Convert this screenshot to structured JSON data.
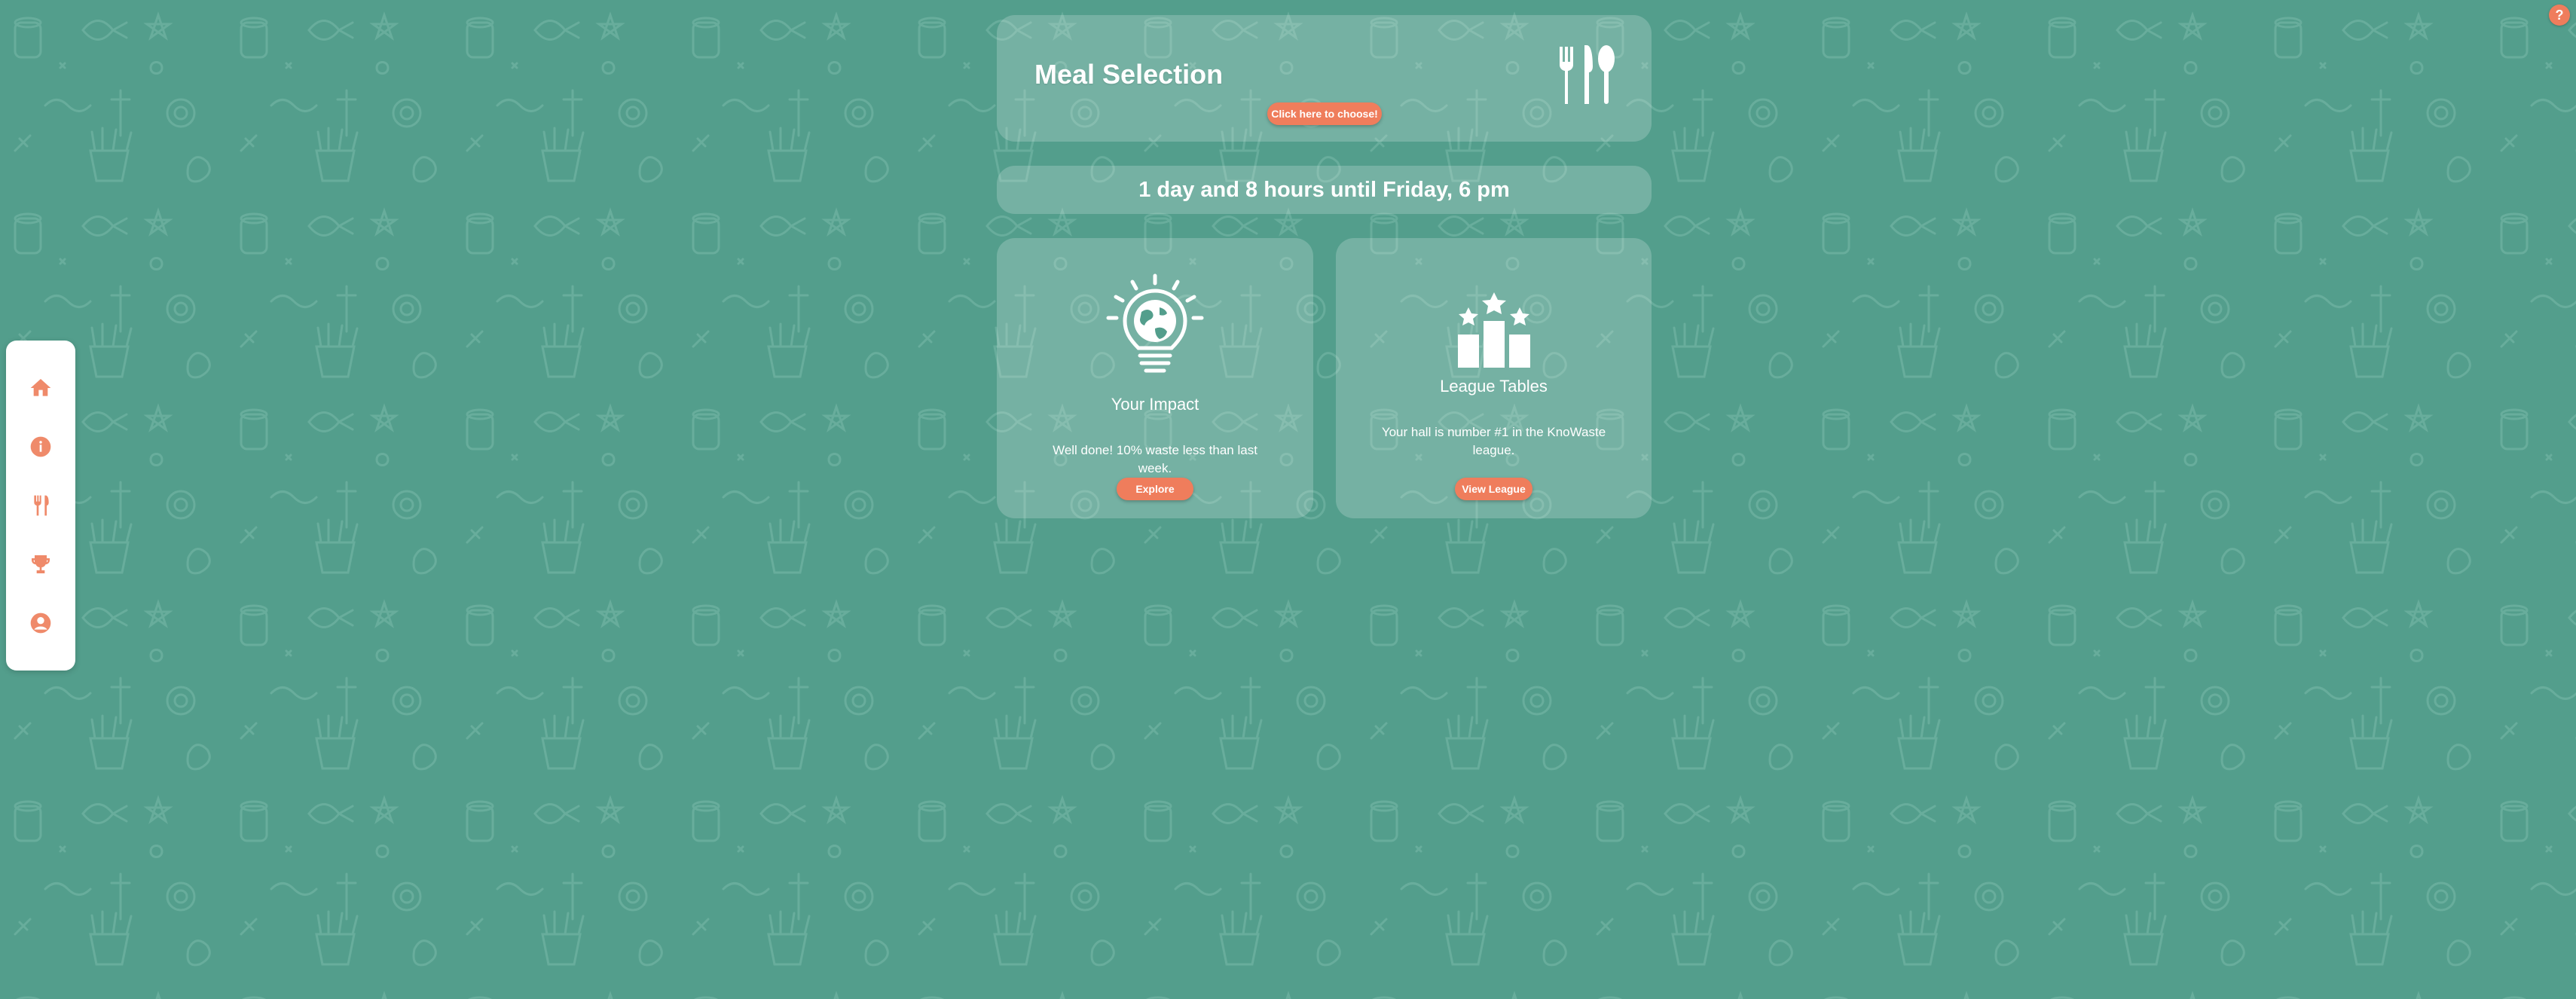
{
  "help": {
    "label": "?"
  },
  "sidebar": {
    "items": [
      {
        "icon": "home-icon"
      },
      {
        "icon": "info-icon"
      },
      {
        "icon": "cutlery-icon"
      },
      {
        "icon": "trophy-icon"
      },
      {
        "icon": "user-icon"
      }
    ]
  },
  "meal_selection": {
    "title": "Meal Selection",
    "button_label": "Click here to choose!",
    "icon": "cutlery-icon"
  },
  "countdown": {
    "text": "1 day and 8 hours until Friday, 6 pm"
  },
  "impact": {
    "title": "Your Impact",
    "text": "Well done! 10% waste less than last week.",
    "button_label": "Explore",
    "icon": "lightbulb-globe-icon"
  },
  "league": {
    "title": "League Tables",
    "text": "Your hall is number #1 in the KnoWaste league.",
    "button_label": "View League",
    "icon": "podium-stars-icon"
  },
  "colors": {
    "background": "#539e8c",
    "accent": "#ef7d5c",
    "nav_icon": "#ef8a6a",
    "card": "rgba(255,255,255,0.20)"
  }
}
